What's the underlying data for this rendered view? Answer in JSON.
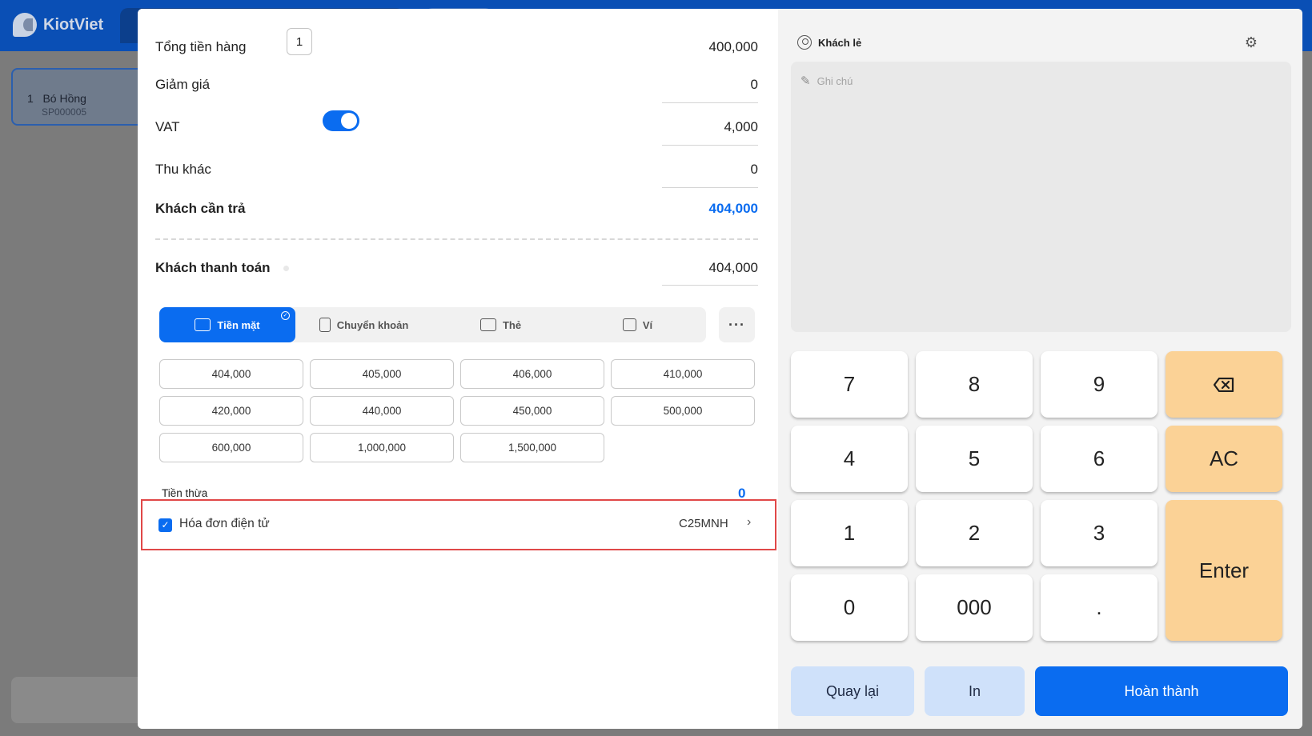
{
  "app": {
    "brand": "KiotViet"
  },
  "background": {
    "item_index": "1",
    "item_name": "Bó Hồng",
    "item_code": "SP000005"
  },
  "summary": {
    "total_goods_label": "Tổng tiền hàng",
    "total_goods_qty": "1",
    "total_goods_value": "400,000",
    "discount_label": "Giảm giá",
    "discount_value": "0",
    "vat_label": "VAT",
    "vat_enabled": true,
    "vat_value": "4,000",
    "other_label": "Thu khác",
    "other_value": "0",
    "due_label": "Khách cần trả",
    "due_value": "404,000",
    "paid_label": "Khách thanh toán",
    "paid_value": "404,000"
  },
  "payment_methods": [
    {
      "label": "Tiền mặt",
      "icon": "cash-icon",
      "active": true
    },
    {
      "label": "Chuyển khoản",
      "icon": "transfer-icon",
      "active": false
    },
    {
      "label": "Thẻ",
      "icon": "card-icon",
      "active": false
    },
    {
      "label": "Ví",
      "icon": "wallet-icon",
      "active": false
    }
  ],
  "more_label": "···",
  "quick_amounts": [
    "404,000",
    "405,000",
    "406,000",
    "410,000",
    "420,000",
    "440,000",
    "450,000",
    "500,000",
    "600,000",
    "1,000,000",
    "1,500,000"
  ],
  "change": {
    "label": "Tiền thừa",
    "value": "0"
  },
  "invoice": {
    "label": "Hóa đơn điện tử",
    "checked": true,
    "code": "C25MNH"
  },
  "customer": {
    "name": "Khách lẻ",
    "icon": "user-icon"
  },
  "note": {
    "placeholder": "Ghi chú"
  },
  "keypad": {
    "keys": [
      "7",
      "8",
      "9",
      "4",
      "5",
      "6",
      "1",
      "2",
      "3",
      "0",
      "000",
      "."
    ],
    "clear_label": "AC",
    "enter_label": "Enter"
  },
  "actions": {
    "back_label": "Quay lại",
    "print_label": "In",
    "done_label": "Hoàn thành"
  },
  "colors": {
    "accent": "#0a6cf0",
    "highlight": "#e04848",
    "key_orange": "#fbd296"
  }
}
